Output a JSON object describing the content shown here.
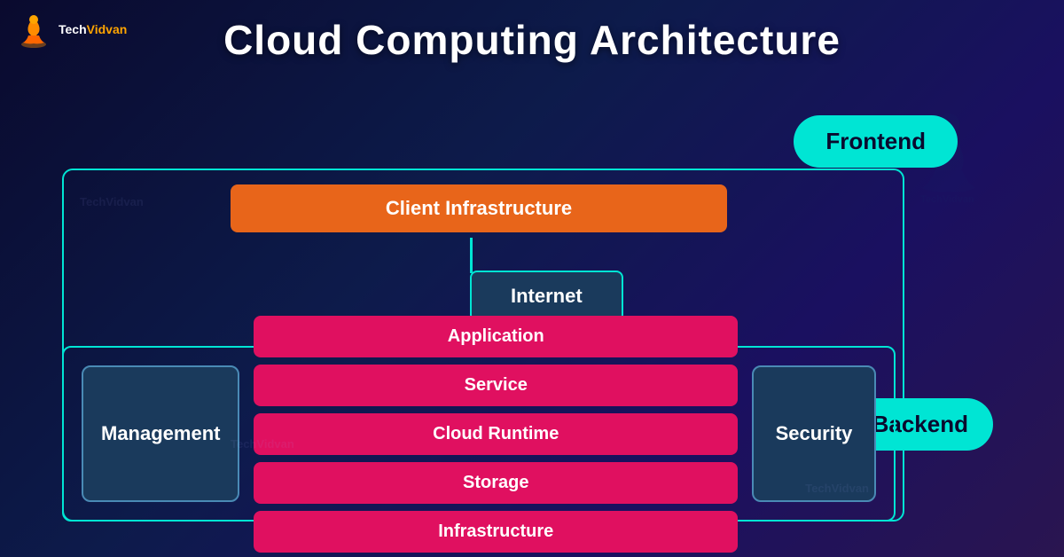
{
  "logo": {
    "text_tech": "Tech",
    "text_vidvan": "Vidvan"
  },
  "title": "Cloud Computing Architecture",
  "badges": {
    "frontend": "Frontend",
    "backend": "Backend"
  },
  "nodes": {
    "client_infrastructure": "Client Infrastructure",
    "internet": "Internet",
    "management": "Management",
    "security": "Security"
  },
  "layers": [
    "Application",
    "Service",
    "Cloud Runtime",
    "Storage",
    "Infrastructure"
  ]
}
